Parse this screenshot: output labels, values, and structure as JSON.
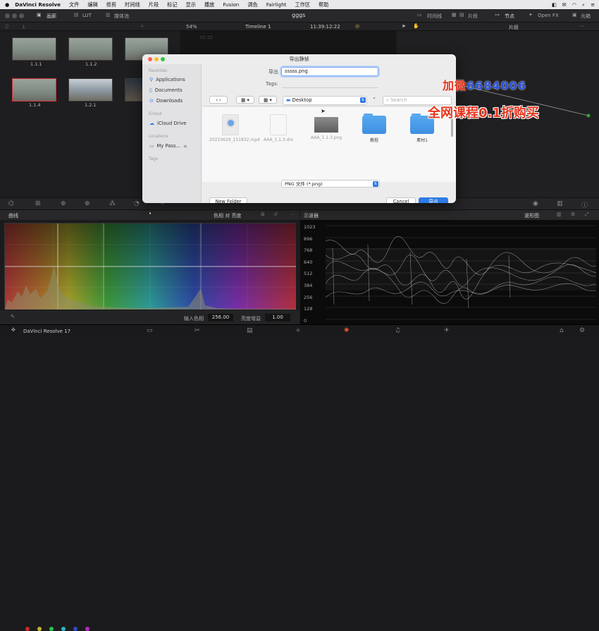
{
  "menubar": {
    "app": "DaVinci Resolve",
    "items": [
      "文件",
      "编辑",
      "修剪",
      "时间线",
      "片段",
      "标记",
      "显示",
      "播放",
      "Fusion",
      "调色",
      "Fairlight",
      "工作区",
      "帮助"
    ]
  },
  "topbar": {
    "gallery": "画廊",
    "lut": "LUT",
    "mediapool": "媒体池",
    "project_title": "gggs",
    "timeline_btn": "时间线",
    "clips_btn": "片段",
    "nodes_btn": "节点",
    "openfx_btn": "Open FX",
    "light_box": "光箱"
  },
  "subbar": {
    "zoom": "54%",
    "timeline_name": "Timeline 1",
    "timecode": "11:39:12:22",
    "clip_menu": "片段"
  },
  "clips": [
    {
      "label": "1.1.1"
    },
    {
      "label": "1.1.2"
    },
    {
      "label": "1.1.4"
    },
    {
      "label": "1.2.1"
    }
  ],
  "dialog": {
    "title": "导出静帧",
    "save_as_label": "导出",
    "save_as_value": "sssss.png",
    "tags_label": "Tags:",
    "location": "Desktop",
    "search_placeholder": "Search",
    "sidebar": {
      "favorites_head": "Favorites",
      "favorites": [
        "Applications",
        "Documents",
        "Downloads"
      ],
      "icloud_head": "iCloud",
      "icloud": [
        "iCloud Drive"
      ],
      "locations_head": "Locations",
      "locations": [
        "My Pass..."
      ],
      "tags_head": "Tags"
    },
    "files": [
      {
        "name": "20210629_151832.mp4",
        "kind": "mp4"
      },
      {
        "name": "AAA_1.1.3.drx",
        "kind": "doc"
      },
      {
        "name": "AAA_1.1.3.png",
        "kind": "img"
      },
      {
        "name": "教程",
        "kind": "folder"
      },
      {
        "name": "素材1",
        "kind": "folder"
      }
    ],
    "format": "PNG 文件 (*.png)",
    "new_folder": "New Folder",
    "cancel": "Cancel",
    "export": "导出"
  },
  "promo": {
    "line1_red": "加微",
    "line1_blue": "6684006",
    "line2": "全网课程0.1折购买"
  },
  "curves": {
    "title": "曲线",
    "mode": "色相 对 亮度",
    "input_hue_label": "输入色相",
    "input_hue_value": "256.00",
    "lum_gain_label": "亮度增益",
    "lum_gain_value": "1.00"
  },
  "scopes": {
    "title": "示波器",
    "mode": "波形图",
    "scale": [
      "1023",
      "896",
      "768",
      "640",
      "512",
      "384",
      "256",
      "128",
      "0"
    ]
  },
  "bottombar": {
    "app_version": "DaVinci Resolve 17"
  },
  "colors": {
    "accent": "#2f7ae5",
    "selection": "#d8323a",
    "promo_red": "#e8341c",
    "promo_blue": "#2b52e0"
  }
}
